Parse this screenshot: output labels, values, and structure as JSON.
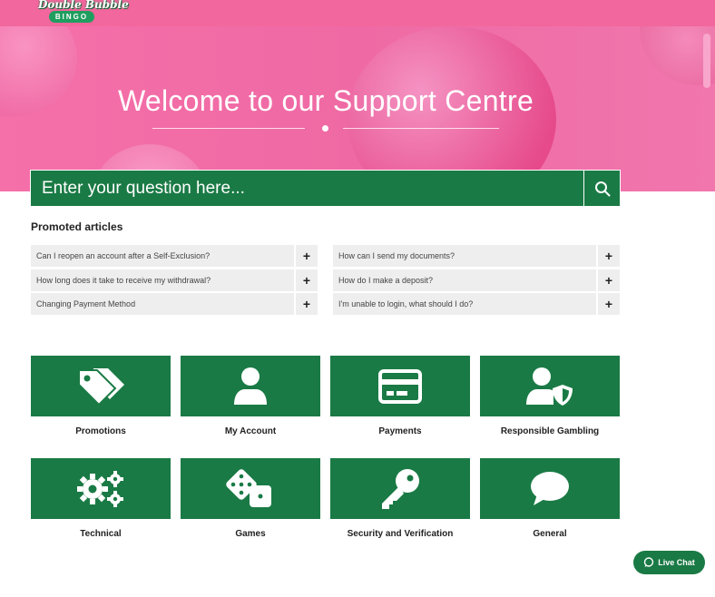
{
  "brand": {
    "name": "Double Bubble",
    "sub": "BINGO"
  },
  "hero": {
    "title": "Welcome to our Support Centre"
  },
  "search": {
    "placeholder": "Enter your question here..."
  },
  "promoted": {
    "title": "Promoted articles",
    "left": [
      "Can I reopen an account after a Self-Exclusion?",
      "How long does it take to receive my withdrawal?",
      "Changing Payment Method"
    ],
    "right": [
      "How can I send my documents?",
      "How do I make a deposit?",
      "I'm unable to login, what should I do?"
    ],
    "plus": "+"
  },
  "categories": [
    {
      "label": "Promotions",
      "icon": "tags-icon"
    },
    {
      "label": "My Account",
      "icon": "user-icon"
    },
    {
      "label": "Payments",
      "icon": "credit-card-icon"
    },
    {
      "label": "Responsible Gambling",
      "icon": "user-shield-icon"
    },
    {
      "label": "Technical",
      "icon": "cogs-icon"
    },
    {
      "label": "Games",
      "icon": "dice-icon"
    },
    {
      "label": "Security and Verification",
      "icon": "key-icon"
    },
    {
      "label": "General",
      "icon": "speech-bubble-icon"
    }
  ],
  "livechat": {
    "label": "Live Chat"
  },
  "colors": {
    "green": "#1a7a45",
    "pink": "#f2679d"
  }
}
